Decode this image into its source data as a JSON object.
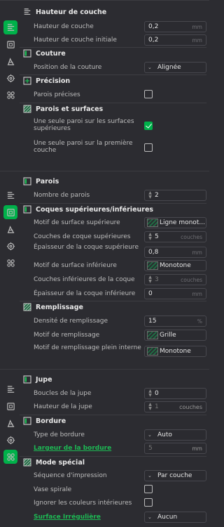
{
  "panel1": {
    "sections": [
      {
        "title": "Hauteur de couche",
        "icon": "layer-height-icon"
      },
      {
        "title": "Couture",
        "icon": "seam-icon"
      },
      {
        "title": "Précision",
        "icon": "precision-icon"
      },
      {
        "title": "Parois et surfaces",
        "icon": "walls-surfaces-icon"
      }
    ],
    "layer_height": {
      "label": "Hauteur de couche",
      "value": "0,2",
      "unit": "mm"
    },
    "initial_layer_height": {
      "label": "Hauteur de couche initiale",
      "value": "0,2",
      "unit": "mm"
    },
    "seam_position": {
      "label": "Position de la couture",
      "value": "Alignée"
    },
    "precise_walls": {
      "label": "Parois précises",
      "checked": false
    },
    "single_wall_top": {
      "label": "Une seule paroi sur les surfaces supérieures",
      "checked": true
    },
    "single_wall_first": {
      "label": "Une seule paroi sur la première couche",
      "checked": false
    }
  },
  "panel2": {
    "sections": [
      {
        "title": "Parois",
        "icon": "walls-icon"
      },
      {
        "title": "Coques supérieures/inférieures",
        "icon": "shells-icon"
      },
      {
        "title": "Remplissage",
        "icon": "infill-icon"
      }
    ],
    "wall_loops": {
      "label": "Nombre de parois",
      "value": "2"
    },
    "top_pattern": {
      "label": "Motif de surface supérieure",
      "value": "Ligne monot..."
    },
    "top_shell_layers": {
      "label": "Couches de coque supérieures",
      "value": "5",
      "unit": "couches"
    },
    "top_shell_thickness": {
      "label": "Épaisseur de la coque supérieure",
      "value": "0,8",
      "unit": "mm"
    },
    "bottom_pattern": {
      "label": "Motif de surface inférieure",
      "value": "Monotone"
    },
    "bottom_shell_layers": {
      "label": "Couches inférieures de la coque",
      "value": "3",
      "unit": "couches"
    },
    "bottom_shell_thickness": {
      "label": "Épaisseur de la coque inférieure",
      "value": "0",
      "unit": "mm"
    },
    "infill_density": {
      "label": "Densité de remplissage",
      "value": "15",
      "unit": "%"
    },
    "infill_pattern": {
      "label": "Motif de remplissage",
      "value": "Grille"
    },
    "solid_infill_pattern": {
      "label": "Motif de remplissage plein interne",
      "value": "Monotone"
    }
  },
  "panel3": {
    "sections": [
      {
        "title": "Jupe",
        "icon": "skirt-icon"
      },
      {
        "title": "Bordure",
        "icon": "brim-icon"
      },
      {
        "title": "Mode spécial",
        "icon": "special-mode-icon"
      }
    ],
    "skirt_loops": {
      "label": "Boucles de la jupe",
      "value": "0"
    },
    "skirt_height": {
      "label": "Hauteur de la jupe",
      "value": "1",
      "unit": "couches"
    },
    "brim_type": {
      "label": "Type de bordure",
      "value": "Auto"
    },
    "brim_width": {
      "label": "Largeur de la bordure",
      "value": "5",
      "unit": "mm"
    },
    "print_sequence": {
      "label": "Séquence d'impression",
      "value": "Par couche"
    },
    "spiral_vase": {
      "label": "Vase spirale",
      "checked": false
    },
    "ignore_inner_colors": {
      "label": "Ignorer les couleurs intérieures",
      "checked": false
    },
    "fuzzy_skin": {
      "label": "Surface Irrégulière",
      "value": "Aucun"
    }
  },
  "rail_icons": [
    "quality-icon",
    "strength-icon",
    "support-icon",
    "filament-icon",
    "others-icon"
  ],
  "colors": {
    "accent": "#00b14a",
    "background": "#2c2c31",
    "link": "#1db954"
  }
}
